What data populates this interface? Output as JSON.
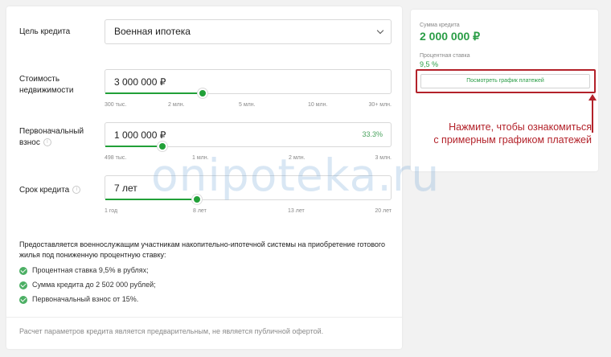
{
  "form": {
    "purpose_label": "Цель кредита",
    "purpose_value": "Военная ипотека",
    "property_label_line1": "Стоимость",
    "property_label_line2": "недвижимости",
    "property_value": "3 000 000 ₽",
    "property_level": 0.34,
    "property_ticks": [
      "300 тыс.",
      "2 млн.",
      "5 млн.",
      "10 млн.",
      "30+ млн."
    ],
    "down_label_line1": "Первоначальный",
    "down_label_line2": "взнос",
    "down_value": "1 000 000 ₽",
    "down_percent": "33.3%",
    "down_level": 0.2,
    "down_ticks": [
      "498 тыс.",
      "1 млн.",
      "2 млн.",
      "3 млн."
    ],
    "term_label": "Срок кредита",
    "term_value": "7 лет",
    "term_level": 0.32,
    "term_ticks": [
      "1 год",
      "8 лет",
      "13 лет",
      "20 лет"
    ],
    "info_glyph": "i"
  },
  "description": {
    "text": "Предоставляется военнослужащим участникам накопительно-ипотечной системы на приобретение готового жилья под пониженную процентную ставку:",
    "bullets": [
      "Процентная ставка 9,5% в рублях;",
      "Сумма кредита до 2 502 000 рублей;",
      "Первоначальный взнос от 15%."
    ],
    "disclaimer": "Расчет параметров кредита является предварительным, не является публичной офертой."
  },
  "summary": {
    "sum_label": "Сумма кредита",
    "sum_value": "2 000 000 ₽",
    "rate_label": "Процентная ставка",
    "rate_value": "9,5 %",
    "schedule_button": "Посмотреть график платежей"
  },
  "annotation": {
    "line1": "Нажмите, чтобы ознакомиться",
    "line2": "с примерным графиком платежей"
  },
  "watermark": "onipoteka.ru",
  "colors": {
    "accent": "#21a038",
    "annotation_red": "#b3222a"
  }
}
